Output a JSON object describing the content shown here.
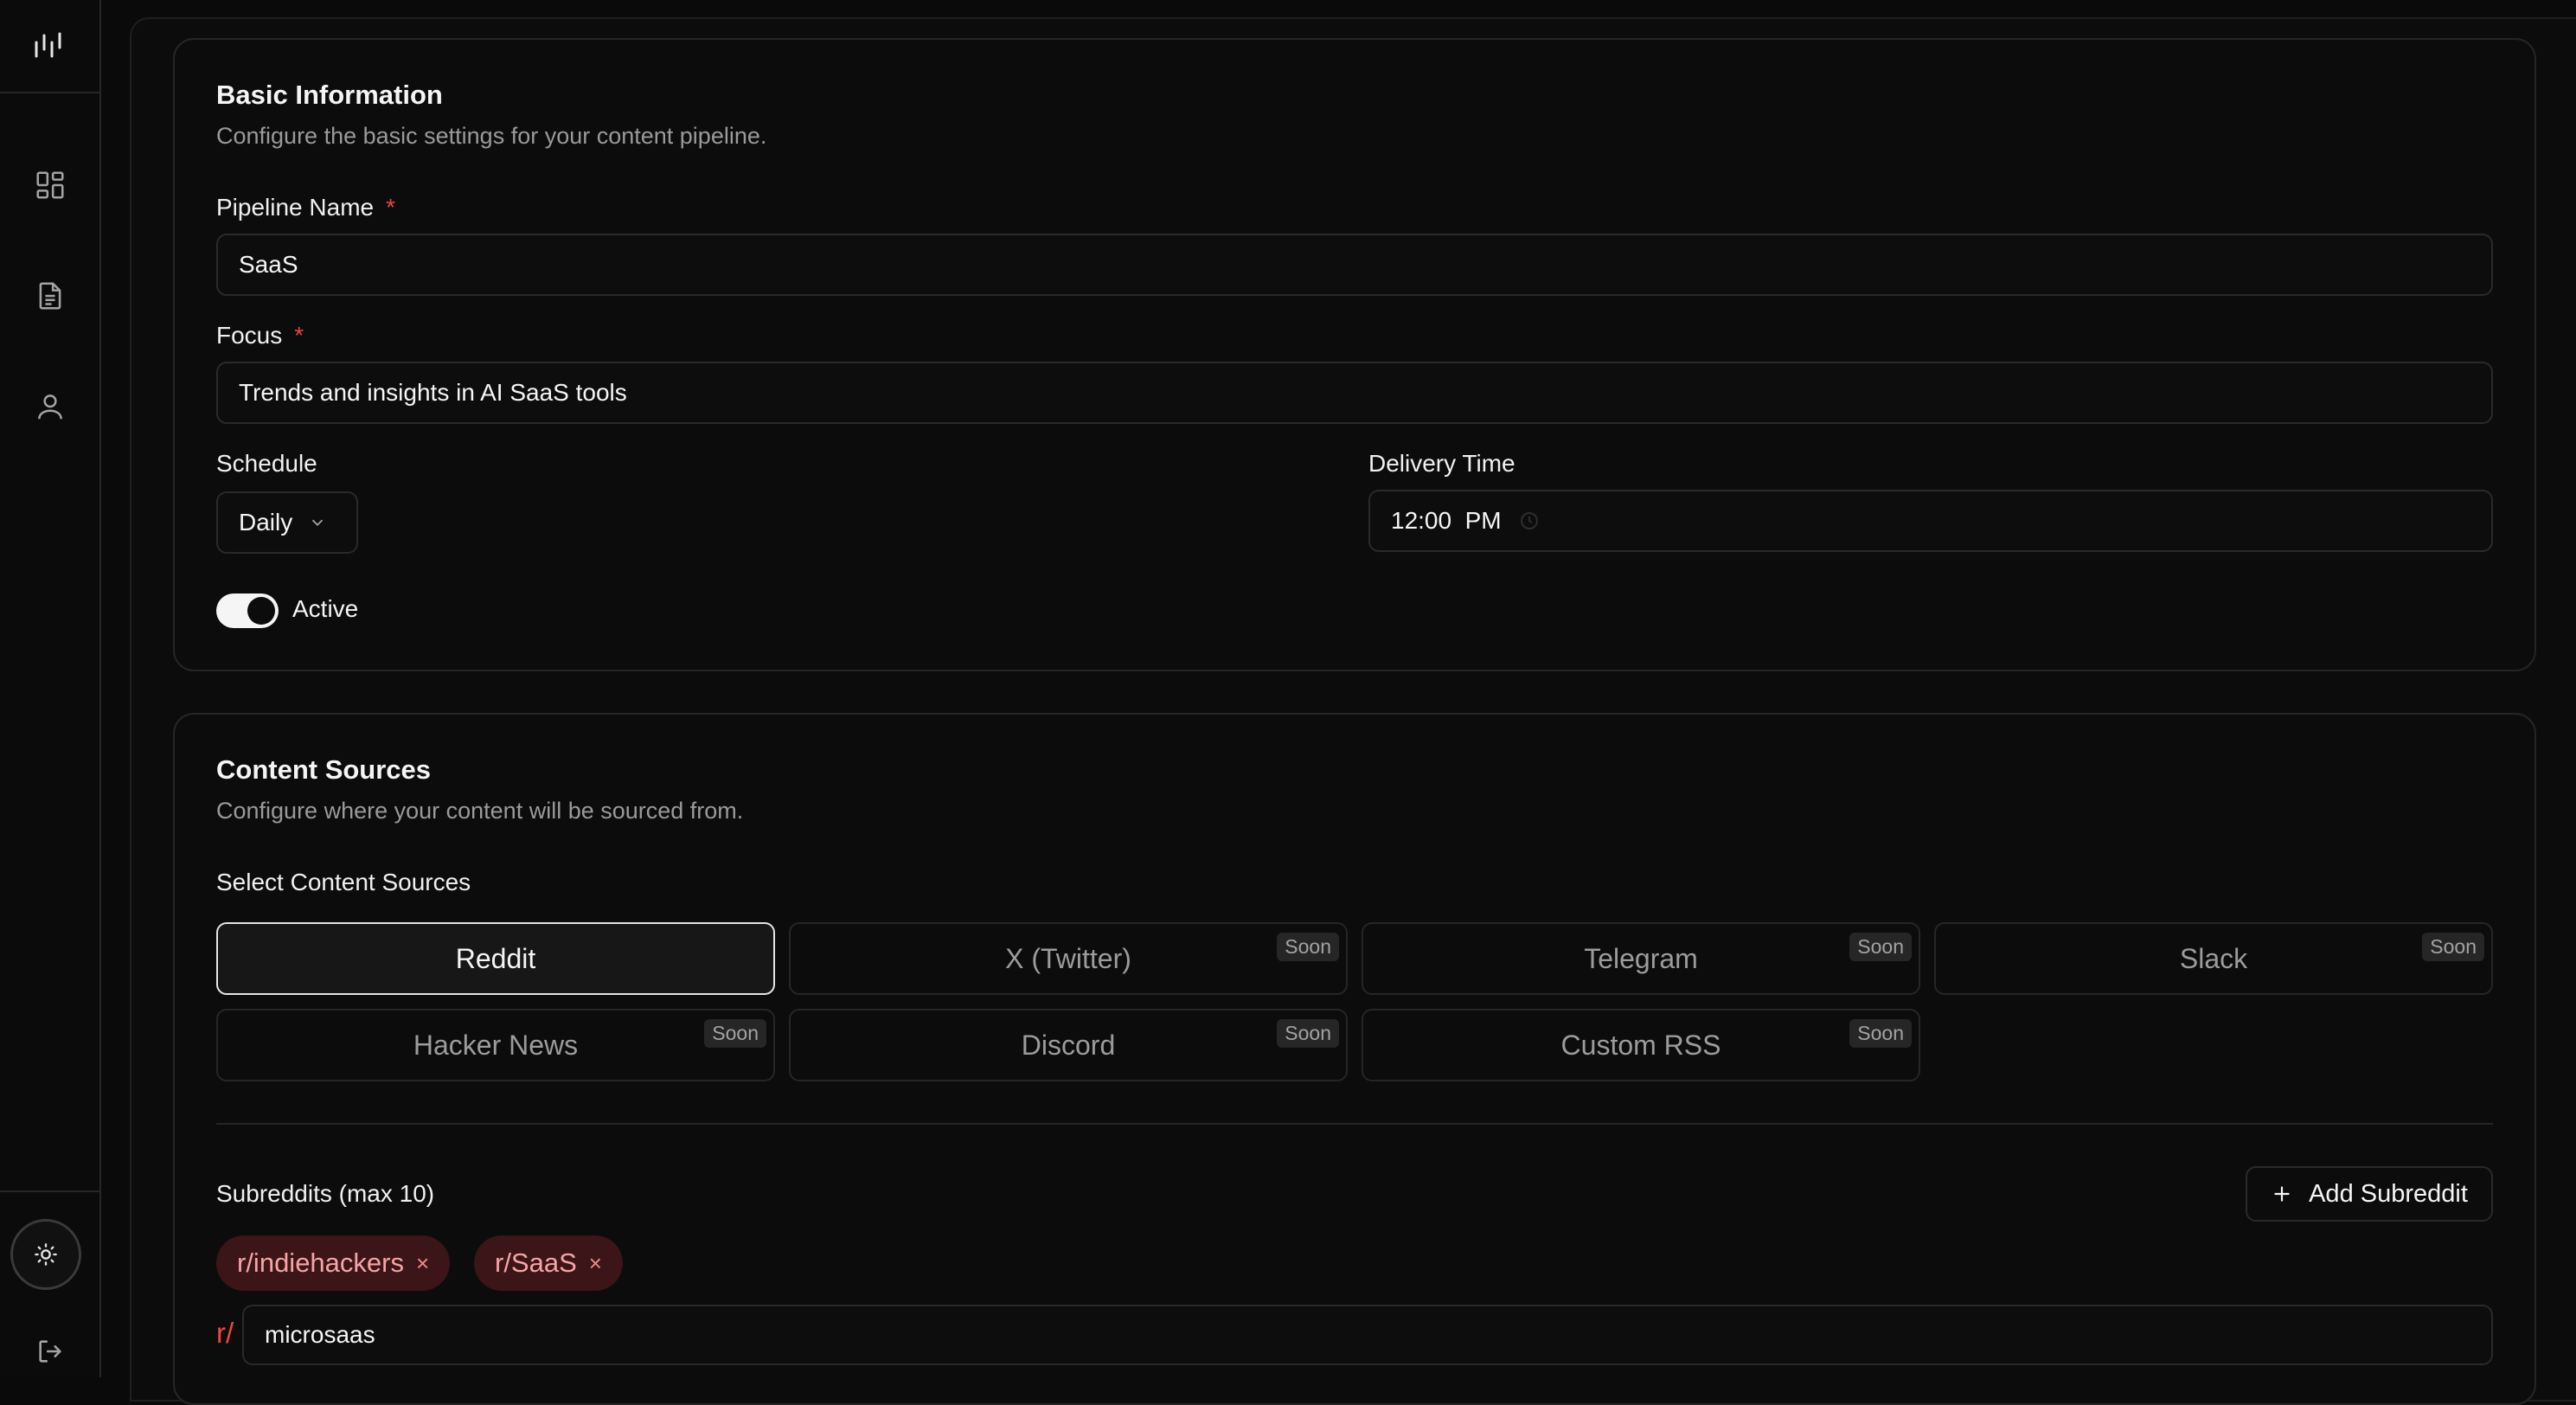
{
  "basic": {
    "title": "Basic Information",
    "subtitle": "Configure the basic settings for your content pipeline.",
    "pipeline_name_label": "Pipeline Name",
    "pipeline_name_value": "SaaS",
    "required_mark": "*",
    "focus_label": "Focus",
    "focus_value": "Trends and insights in AI SaaS tools",
    "schedule_label": "Schedule",
    "schedule_value": "Daily",
    "delivery_label": "Delivery Time",
    "delivery_value": "12:00  PM",
    "active_label": "Active",
    "active_on": true
  },
  "sources": {
    "title": "Content Sources",
    "subtitle": "Configure where your content will be sourced from.",
    "select_label": "Select Content Sources",
    "soon_label": "Soon",
    "items": [
      {
        "label": "Reddit",
        "selected": true,
        "soon": false
      },
      {
        "label": "X (Twitter)",
        "selected": false,
        "soon": true
      },
      {
        "label": "Telegram",
        "selected": false,
        "soon": true
      },
      {
        "label": "Slack",
        "selected": false,
        "soon": true
      },
      {
        "label": "Hacker News",
        "selected": false,
        "soon": true
      },
      {
        "label": "Discord",
        "selected": false,
        "soon": true
      },
      {
        "label": "Custom RSS",
        "selected": false,
        "soon": true
      }
    ],
    "subreddits_label": "Subreddits (max 10)",
    "add_subreddit_label": "Add Subreddit",
    "chips": [
      "r/indiehackers",
      "r/SaaS"
    ],
    "chip_remove": "×",
    "input_prefix": "r/",
    "input_value": "microsaas"
  },
  "icons": {
    "logo": "waveform-logo-icon",
    "dashboard": "dashboard-grid-icon",
    "document": "document-icon",
    "user": "user-icon",
    "theme": "sun-icon",
    "logout": "logout-icon"
  },
  "colors": {
    "accent_required": "#ef4444",
    "chip_bg": "#3b1517",
    "chip_text": "#f5a5a5"
  }
}
